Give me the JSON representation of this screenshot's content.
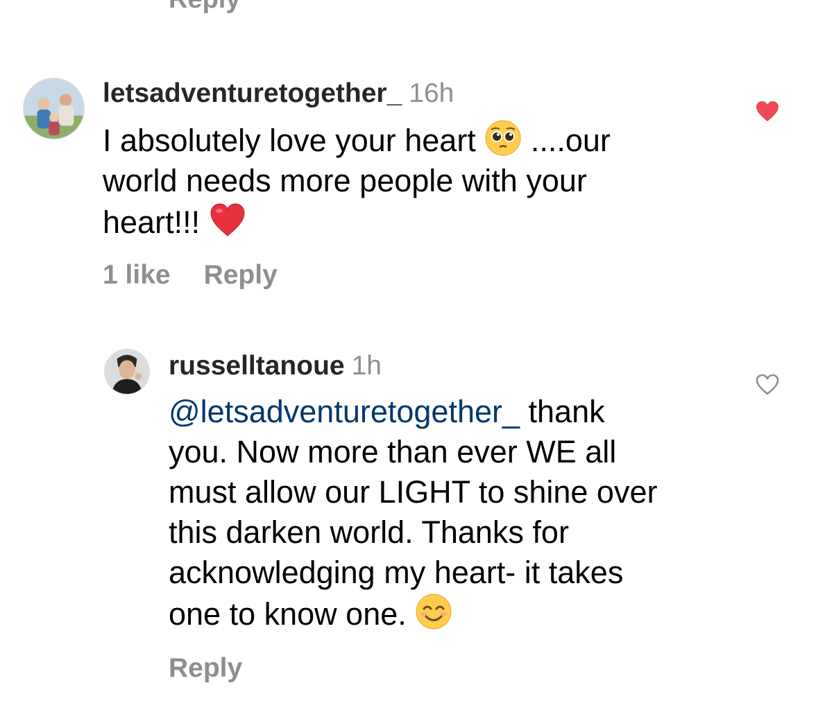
{
  "previous_comment": {
    "reply_label": "Reply"
  },
  "comments": [
    {
      "username": "letsadventuretogether_",
      "time": "16h",
      "text_lines": [
        "I absolutely love your heart",
        "....our",
        "world needs more people with your",
        "heart!!!"
      ],
      "emojis": [
        "pleading-face-emoji",
        "red-heart-emoji"
      ],
      "likes_label": "1 like",
      "reply_label": "Reply",
      "liked": true,
      "like_color": "#ed4956"
    },
    {
      "username": "russelltanoue",
      "time": "1h",
      "mention": "@letsadventuretogether_",
      "text_lines": [
        "thank",
        "you. Now more than ever WE all",
        "must allow our LIGHT to shine over",
        "this darken world.  Thanks for",
        "acknowledging my heart- it takes",
        "one to know one."
      ],
      "emojis": [
        "smiling-face-emoji"
      ],
      "reply_label": "Reply",
      "liked": false
    }
  ],
  "colors": {
    "secondary_text": "#8e8e8e",
    "mention": "#00376b",
    "like": "#ed4956"
  }
}
